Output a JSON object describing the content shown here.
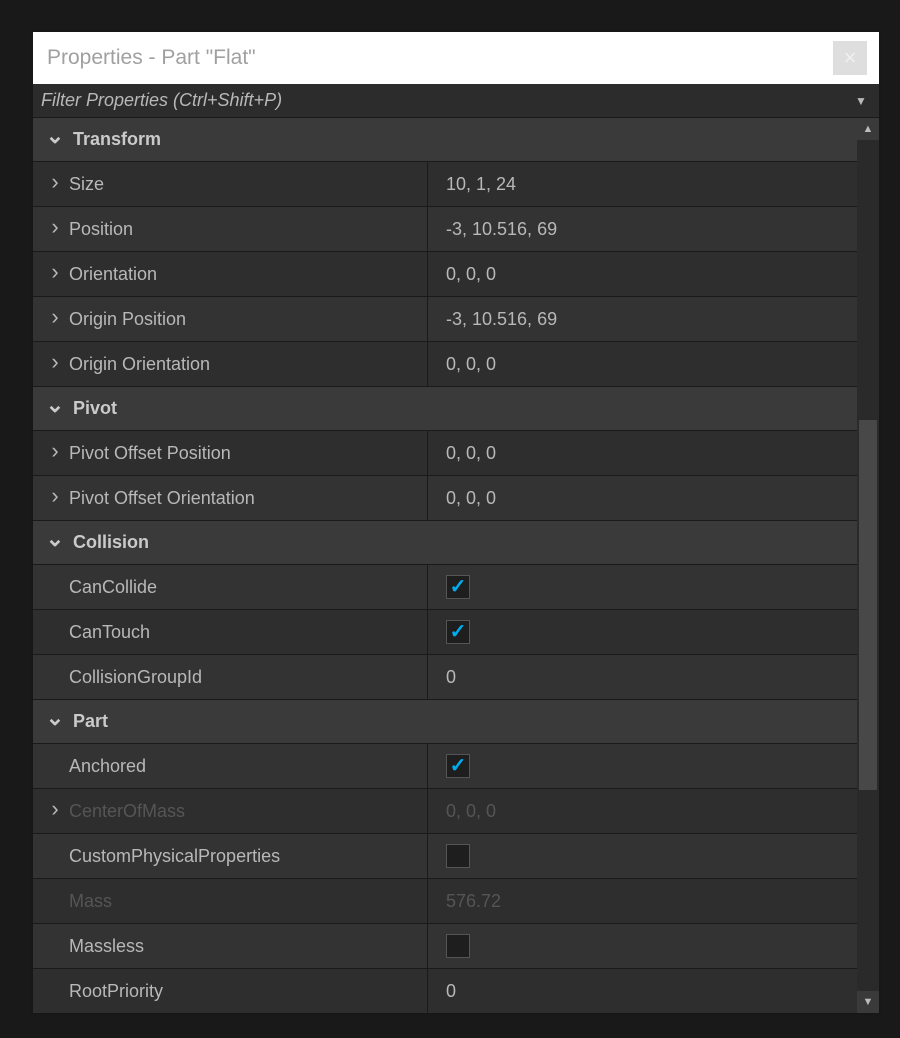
{
  "header": {
    "title": "Properties - Part \"Flat\"",
    "close_label": "×"
  },
  "filter": {
    "placeholder": "Filter Properties (Ctrl+Shift+P)"
  },
  "sections": [
    {
      "name": "Transform",
      "rows": [
        {
          "key": "size",
          "label": "Size",
          "value": "10, 1, 24",
          "expandable": true
        },
        {
          "key": "position",
          "label": "Position",
          "value": "-3, 10.516, 69",
          "expandable": true
        },
        {
          "key": "orientation",
          "label": "Orientation",
          "value": "0, 0, 0",
          "expandable": true
        },
        {
          "key": "origin_position",
          "label": "Origin Position",
          "value": "-3, 10.516, 69",
          "expandable": true
        },
        {
          "key": "origin_orientation",
          "label": "Origin Orientation",
          "value": "0, 0, 0",
          "expandable": true
        }
      ]
    },
    {
      "name": "Pivot",
      "rows": [
        {
          "key": "pivot_offset_position",
          "label": "Pivot Offset Position",
          "value": "0, 0, 0",
          "expandable": true
        },
        {
          "key": "pivot_offset_orientation",
          "label": "Pivot Offset Orientation",
          "value": "0, 0, 0",
          "expandable": true
        }
      ]
    },
    {
      "name": "Collision",
      "rows": [
        {
          "key": "cancollide",
          "label": "CanCollide",
          "type": "checkbox",
          "checked": true
        },
        {
          "key": "cantouch",
          "label": "CanTouch",
          "type": "checkbox",
          "checked": true
        },
        {
          "key": "collisiongroupid",
          "label": "CollisionGroupId",
          "value": "0"
        }
      ]
    },
    {
      "name": "Part",
      "rows": [
        {
          "key": "anchored",
          "label": "Anchored",
          "type": "checkbox",
          "checked": true
        },
        {
          "key": "centerofmass",
          "label": "CenterOfMass",
          "value": "0, 0, 0",
          "expandable": true,
          "readonly": true
        },
        {
          "key": "customphysical",
          "label": "CustomPhysicalProperties",
          "type": "checkbox",
          "checked": false
        },
        {
          "key": "mass",
          "label": "Mass",
          "value": "576.72",
          "readonly": true
        },
        {
          "key": "massless",
          "label": "Massless",
          "type": "checkbox",
          "checked": false
        },
        {
          "key": "rootpriority",
          "label": "RootPriority",
          "value": "0"
        }
      ]
    }
  ]
}
